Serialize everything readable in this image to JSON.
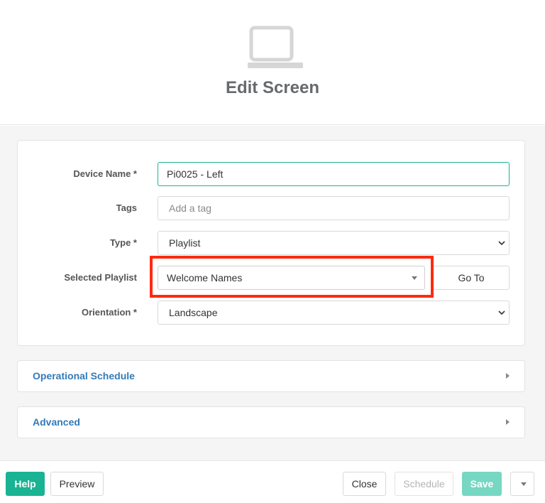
{
  "header": {
    "icon": "laptop-icon",
    "title": "Edit Screen"
  },
  "form": {
    "device_name": {
      "label": "Device Name *",
      "value": "Pi0025 - Left"
    },
    "tags": {
      "label": "Tags",
      "placeholder": "Add a tag"
    },
    "type": {
      "label": "Type *",
      "value": "Playlist"
    },
    "selected_playlist": {
      "label": "Selected Playlist",
      "value": "Welcome Names",
      "goto_label": "Go To"
    },
    "orientation": {
      "label": "Orientation *",
      "value": "Landscape"
    }
  },
  "panels": [
    {
      "title": "Operational Schedule"
    },
    {
      "title": "Advanced"
    }
  ],
  "footer": {
    "help": "Help",
    "preview": "Preview",
    "close": "Close",
    "schedule": "Schedule",
    "save": "Save"
  },
  "colors": {
    "accent": "#1ab394",
    "highlight": "#ff2a10",
    "link": "#337ab7"
  }
}
